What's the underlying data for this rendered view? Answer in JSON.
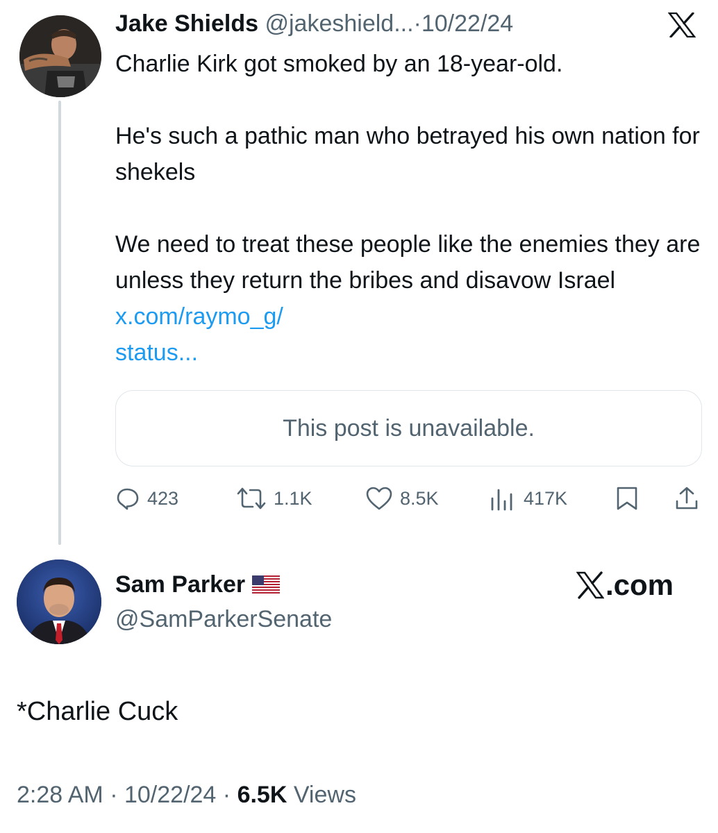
{
  "tweet1": {
    "name": "Jake Shields",
    "handle": "@jakeshield...",
    "sep": "·",
    "date": "10/22/24",
    "text": "Charlie Kirk got smoked by an 18-year-old.\n\nHe's such a pathic man who betrayed his own nation for shekels\n\nWe need to treat these people like the enemies they are unless they return the bribes and disavow Israel ",
    "link_text": "x.com/raymo_g/\nstatus...",
    "quote_unavailable": "This post is unavailable.",
    "actions": {
      "replies": "423",
      "reposts": "1.1K",
      "likes": "8.5K",
      "views": "417K"
    }
  },
  "tweet2": {
    "name": "Sam Parker",
    "handle": "@SamParkerSenate",
    "brand": ".com",
    "text": "*Charlie Cuck",
    "time": "2:28 AM",
    "sep": "·",
    "date": "10/22/24",
    "views_count": "6.5K",
    "views_label": "Views"
  },
  "icons": {
    "x_logo": "x-logo-icon",
    "reply": "reply-icon",
    "repost": "repost-icon",
    "like": "heart-icon",
    "views": "views-icon",
    "bookmark": "bookmark-icon",
    "share": "share-icon",
    "flag": "us-flag-icon"
  },
  "colors": {
    "link": "#1d9bf0",
    "secondary": "#536471",
    "text": "#0f1419",
    "border": "#e1e6ea"
  }
}
